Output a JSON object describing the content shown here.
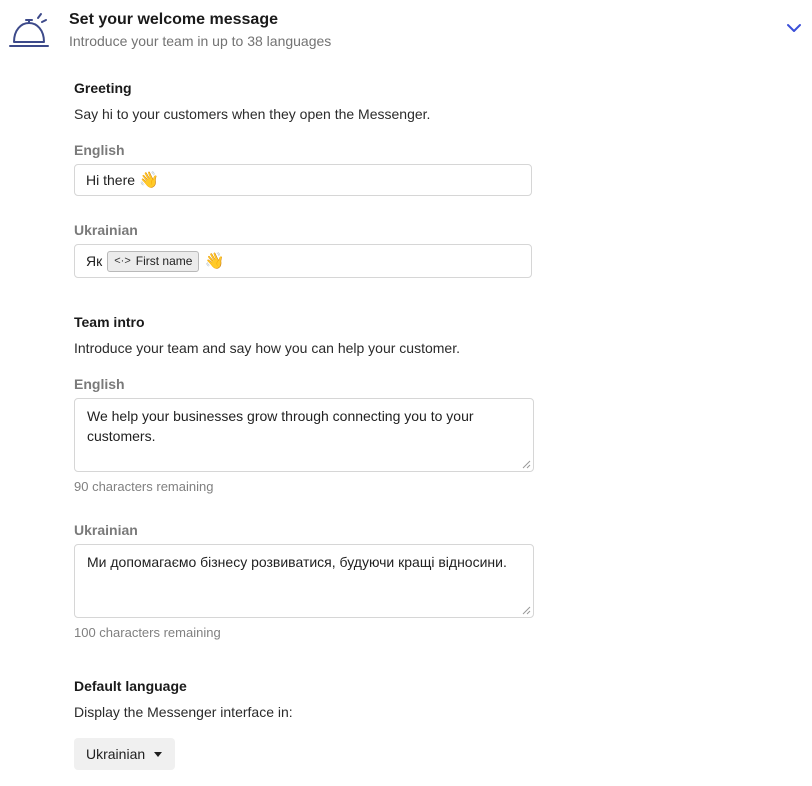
{
  "header": {
    "title": "Set your welcome message",
    "subtitle": "Introduce your team in up to 38 languages",
    "icon": "concierge-bell-icon",
    "toggle_icon": "chevron-down-icon",
    "accent_color": "#3b4fd8"
  },
  "greeting": {
    "title": "Greeting",
    "description": "Say hi to your customers when they open the Messenger.",
    "fields": [
      {
        "language": "English",
        "prefix": "Hi there",
        "emoji": "👋"
      },
      {
        "language": "Ukrainian",
        "prefix": "Як",
        "chip": {
          "icon": "<·>",
          "label": "First name"
        },
        "emoji": "👋"
      }
    ]
  },
  "team_intro": {
    "title": "Team intro",
    "description": "Introduce your team and say how you can help your customer.",
    "fields": [
      {
        "language": "English",
        "value": "We help your businesses grow through connecting you to your customers.",
        "remaining": "90 characters remaining"
      },
      {
        "language": "Ukrainian",
        "value": "Ми допомагаємо бізнесу розвиватися, будуючи кращі відносини.",
        "remaining": "100 characters remaining"
      }
    ]
  },
  "default_language": {
    "title": "Default language",
    "description": "Display the Messenger interface in:",
    "selected": "Ukrainian"
  }
}
